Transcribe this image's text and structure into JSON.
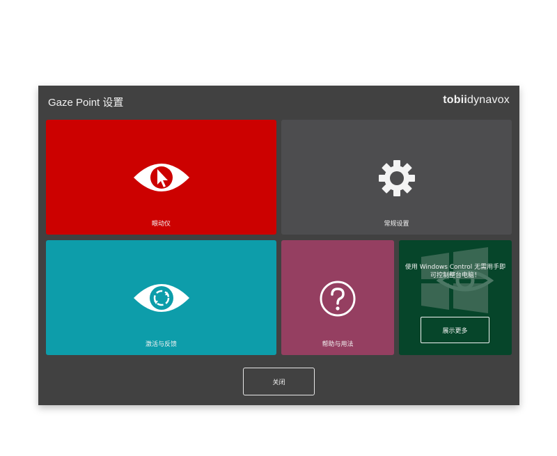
{
  "window": {
    "title": "Gaze Point 设置",
    "brand_bold": "tobii",
    "brand_light": "dynavox"
  },
  "tiles": {
    "eye_tracker": {
      "label": "眼动仪",
      "color": "#cc0100",
      "icon": "eye-cursor-icon"
    },
    "general_settings": {
      "label": "常规设置",
      "color": "#4d4d4f",
      "icon": "gear-icon"
    },
    "activation_feedback": {
      "label": "激活与反馈",
      "color": "#0d9daa",
      "icon": "eye-refresh-icon"
    },
    "help_usage": {
      "label": "帮助与用法",
      "color": "#953f61",
      "icon": "question-icon"
    },
    "windows_control": {
      "text": "使用 Windows Control 无需用手即可控制整台电脑！",
      "button_label": "展示更多",
      "color": "#06452a",
      "icon": "windows-eye-logo-icon"
    }
  },
  "footer": {
    "close_label": "关闭"
  }
}
